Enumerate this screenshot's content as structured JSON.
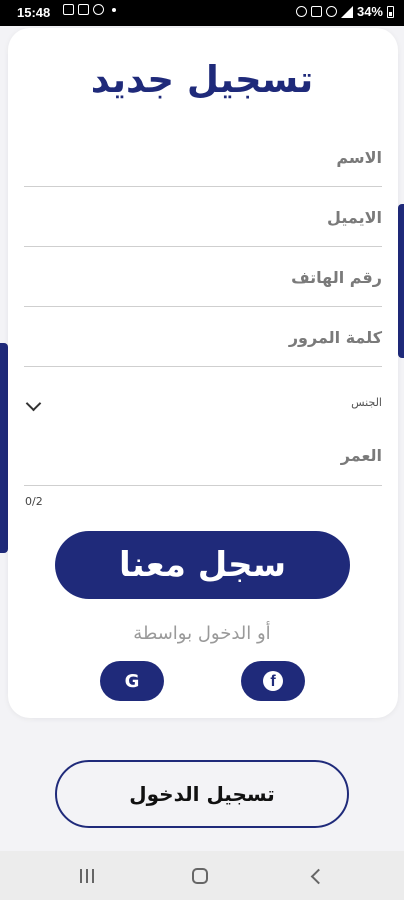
{
  "status_bar": {
    "time": "15:48",
    "battery": "34%",
    "left_icons": [
      "gallery-icon",
      "message-icon",
      "whatsapp-icon",
      "notification-dot-icon"
    ],
    "right_icons": [
      "alarm-icon",
      "mute-icon",
      "wifi-icon",
      "signal-icon",
      "battery-icon"
    ]
  },
  "form": {
    "title": "تسجيل جديد",
    "fields": {
      "name": "الاسم",
      "email": "الايميل",
      "phone": "رقم الهاتف",
      "password": "كلمة المرور",
      "gender": "الجنس",
      "age": "العمر"
    },
    "counter": "0/2",
    "submit": "سجل معنا",
    "or_login_via": "أو الدخول بواسطة",
    "google_letter": "G",
    "facebook_letter": "f"
  },
  "login_button": "تسجيل الدخول",
  "colors": {
    "primary": "#1f2a7a",
    "background": "#f3f3f6",
    "label": "#7a7a7a",
    "divider": "#cfcfcf"
  },
  "nav_icons": [
    "recent-apps-icon",
    "home-icon",
    "back-icon"
  ]
}
